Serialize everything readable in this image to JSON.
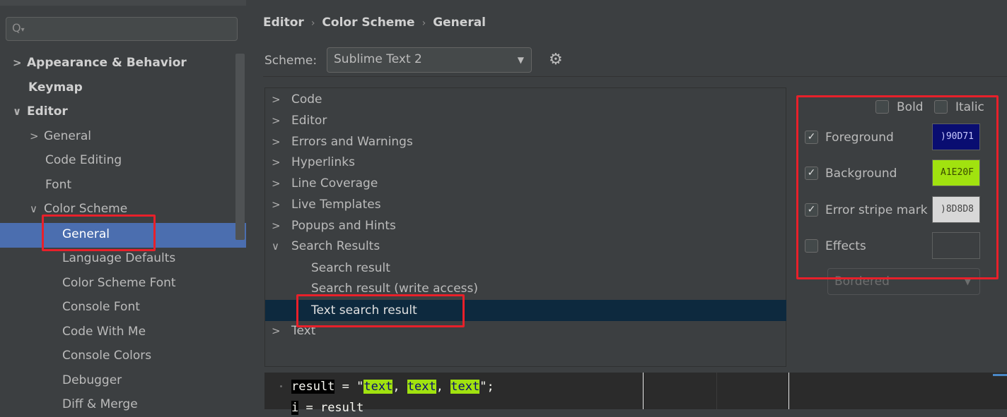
{
  "search": {
    "icon": "search-icon",
    "placeholder": ""
  },
  "sidebar": {
    "items": [
      {
        "label": "Appearance & Behavior",
        "arrow": ">"
      },
      {
        "label": "Keymap",
        "arrow": ""
      },
      {
        "label": "Editor",
        "arrow": "∨"
      },
      {
        "label": "General",
        "arrow": ">"
      },
      {
        "label": "Code Editing",
        "arrow": ""
      },
      {
        "label": "Font",
        "arrow": ""
      },
      {
        "label": "Color Scheme",
        "arrow": "∨"
      },
      {
        "label": "General",
        "arrow": ""
      },
      {
        "label": "Language Defaults",
        "arrow": ""
      },
      {
        "label": "Color Scheme Font",
        "arrow": ""
      },
      {
        "label": "Console Font",
        "arrow": ""
      },
      {
        "label": "Code With Me",
        "arrow": ""
      },
      {
        "label": "Console Colors",
        "arrow": ""
      },
      {
        "label": "Debugger",
        "arrow": ""
      },
      {
        "label": "Diff & Merge",
        "arrow": ""
      }
    ]
  },
  "breadcrumb": {
    "part1": "Editor",
    "part2": "Color Scheme",
    "part3": "General",
    "sep": "›"
  },
  "scheme": {
    "label": "Scheme:",
    "value": "Sublime Text 2",
    "chevron": "▼",
    "gear": "⚙"
  },
  "color_tree": {
    "items": [
      {
        "label": "Code",
        "arrow": ">"
      },
      {
        "label": "Editor",
        "arrow": ">"
      },
      {
        "label": "Errors and Warnings",
        "arrow": ">"
      },
      {
        "label": "Hyperlinks",
        "arrow": ">"
      },
      {
        "label": "Line Coverage",
        "arrow": ">"
      },
      {
        "label": "Live Templates",
        "arrow": ">"
      },
      {
        "label": "Popups and Hints",
        "arrow": ">"
      },
      {
        "label": "Search Results",
        "arrow": "∨"
      },
      {
        "label": "Search result",
        "arrow": ""
      },
      {
        "label": "Search result (write access)",
        "arrow": ""
      },
      {
        "label": "Text search result",
        "arrow": ""
      },
      {
        "label": "Text",
        "arrow": ">"
      }
    ]
  },
  "options": {
    "bold": "Bold",
    "italic": "Italic",
    "foreground": {
      "label": "Foreground",
      "checked": true,
      "swatch_text": ")90D71",
      "color": "#090D71",
      "text_color": "#c8c8ff"
    },
    "background": {
      "label": "Background",
      "checked": true,
      "swatch_text": "A1E20F",
      "color": "#A1E20F",
      "text_color": "#3a4a00"
    },
    "error_stripe": {
      "label": "Error stripe mark",
      "checked": true,
      "swatch_text": ")8D8D8",
      "color": "#D8D8D8",
      "text_color": "#444444"
    },
    "effects": {
      "label": "Effects",
      "checked": false,
      "select_value": "Bordered",
      "chevron": "▼"
    }
  },
  "preview": {
    "line1": {
      "var": "result",
      "eq": " = \"",
      "t1": "text",
      "c1": ", ",
      "t2": "text",
      "c2": ", ",
      "t3": "text",
      "end": "\";"
    },
    "line2": {
      "var": "i",
      "rest": " = result"
    }
  }
}
